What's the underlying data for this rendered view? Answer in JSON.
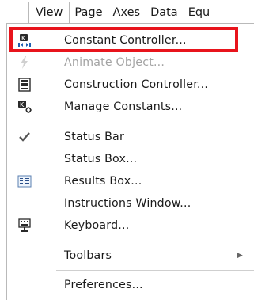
{
  "menubar": {
    "items": [
      "View",
      "Page",
      "Axes",
      "Data",
      "Equ"
    ]
  },
  "menu": {
    "items": [
      {
        "label": "Constant Controller...",
        "icon": "constant-controller-icon",
        "enabled": true
      },
      {
        "label": "Animate Object...",
        "icon": "animate-object-icon",
        "enabled": false
      },
      {
        "label": "Construction Controller...",
        "icon": "construction-controller-icon",
        "enabled": true
      },
      {
        "label": "Manage Constants...",
        "icon": "manage-constants-icon",
        "enabled": true
      },
      {
        "label": "Status Bar",
        "icon": "checkmark-icon",
        "checked": true,
        "enabled": true
      },
      {
        "label": "Status Box...",
        "enabled": true
      },
      {
        "label": "Results Box...",
        "icon": "results-box-icon",
        "enabled": true
      },
      {
        "label": "Instructions Window...",
        "enabled": true
      },
      {
        "label": "Keyboard...",
        "icon": "keyboard-icon",
        "enabled": true
      },
      {
        "label": "Toolbars",
        "submenu": true,
        "enabled": true
      },
      {
        "label": "Preferences...",
        "enabled": true
      }
    ]
  },
  "colors": {
    "highlight_border": "#e8141c",
    "disabled_text": "#a3a3a3"
  }
}
